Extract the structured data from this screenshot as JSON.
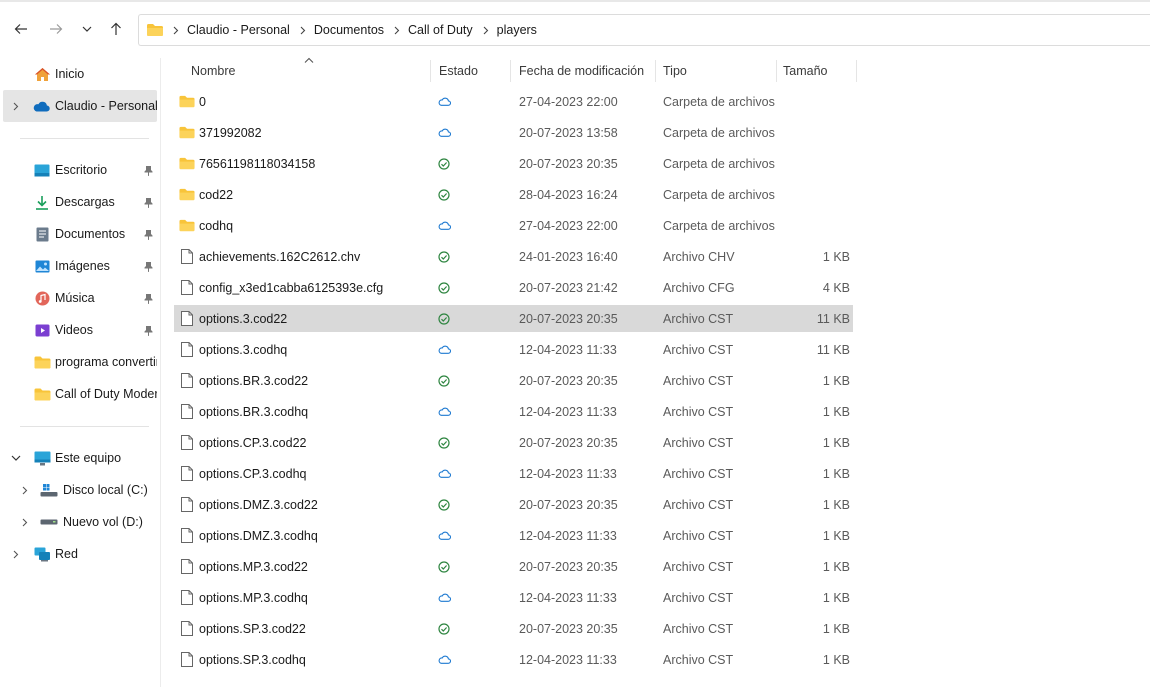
{
  "colors": {
    "accent": "#0078d4",
    "synced": "#2e8540",
    "cloud": "#1f7ad1",
    "folder": "#f8c43a",
    "selected_row": "#d9d9d9"
  },
  "toolbar": {
    "back_icon": "arrow-left-icon",
    "forward_icon": "arrow-right-icon",
    "recent_icon": "chevron-down-icon",
    "up_icon": "arrow-up-icon",
    "breadcrumb": [
      "Claudio - Personal",
      "Documentos",
      "Call of Duty",
      "players"
    ]
  },
  "sidebar": {
    "items": [
      {
        "label": "Inicio",
        "icon": "home-icon"
      },
      {
        "label": "Claudio - Personal",
        "icon": "onedrive-cloud-icon",
        "selected": true
      },
      {
        "label": "Escritorio",
        "icon": "desktop-icon",
        "pinned": true
      },
      {
        "label": "Descargas",
        "icon": "download-icon",
        "pinned": true
      },
      {
        "label": "Documentos",
        "icon": "documents-icon",
        "pinned": true
      },
      {
        "label": "Imágenes",
        "icon": "pictures-icon",
        "pinned": true
      },
      {
        "label": "Música",
        "icon": "music-icon",
        "pinned": true
      },
      {
        "label": "Videos",
        "icon": "videos-icon",
        "pinned": true
      },
      {
        "label": "programa convertir",
        "icon": "folder-icon"
      },
      {
        "label": "Call of Duty  Moder",
        "icon": "folder-icon"
      },
      {
        "label": "Este equipo",
        "icon": "computer-icon"
      },
      {
        "label": "Disco local (C:)",
        "icon": "drive-windows-icon"
      },
      {
        "label": "Nuevo vol (D:)",
        "icon": "drive-icon"
      },
      {
        "label": "Red",
        "icon": "network-icon"
      }
    ]
  },
  "columns": {
    "name": "Nombre",
    "status": "Estado",
    "date": "Fecha de modificación",
    "type": "Tipo",
    "size": "Tamaño"
  },
  "files": [
    {
      "name": "0",
      "kind": "folder",
      "status": "cloud",
      "date": "27-04-2023 22:00",
      "type": "Carpeta de archivos",
      "size": ""
    },
    {
      "name": "371992082",
      "kind": "folder",
      "status": "cloud",
      "date": "20-07-2023 13:58",
      "type": "Carpeta de archivos",
      "size": ""
    },
    {
      "name": "76561198118034158",
      "kind": "folder",
      "status": "synced",
      "date": "20-07-2023 20:35",
      "type": "Carpeta de archivos",
      "size": ""
    },
    {
      "name": "cod22",
      "kind": "folder",
      "status": "synced",
      "date": "28-04-2023 16:24",
      "type": "Carpeta de archivos",
      "size": ""
    },
    {
      "name": "codhq",
      "kind": "folder",
      "status": "cloud",
      "date": "27-04-2023 22:00",
      "type": "Carpeta de archivos",
      "size": ""
    },
    {
      "name": "achievements.162C2612.chv",
      "kind": "file",
      "status": "synced",
      "date": "24-01-2023 16:40",
      "type": "Archivo CHV",
      "size": "1 KB"
    },
    {
      "name": "config_x3ed1cabba6125393e.cfg",
      "kind": "file",
      "status": "synced",
      "date": "20-07-2023 21:42",
      "type": "Archivo CFG",
      "size": "4 KB"
    },
    {
      "name": "options.3.cod22",
      "kind": "file",
      "status": "synced",
      "date": "20-07-2023 20:35",
      "type": "Archivo CST",
      "size": "11 KB",
      "selected": true
    },
    {
      "name": "options.3.codhq",
      "kind": "file",
      "status": "cloud",
      "date": "12-04-2023 11:33",
      "type": "Archivo CST",
      "size": "11 KB"
    },
    {
      "name": "options.BR.3.cod22",
      "kind": "file",
      "status": "synced",
      "date": "20-07-2023 20:35",
      "type": "Archivo CST",
      "size": "1 KB"
    },
    {
      "name": "options.BR.3.codhq",
      "kind": "file",
      "status": "cloud",
      "date": "12-04-2023 11:33",
      "type": "Archivo CST",
      "size": "1 KB"
    },
    {
      "name": "options.CP.3.cod22",
      "kind": "file",
      "status": "synced",
      "date": "20-07-2023 20:35",
      "type": "Archivo CST",
      "size": "1 KB"
    },
    {
      "name": "options.CP.3.codhq",
      "kind": "file",
      "status": "cloud",
      "date": "12-04-2023 11:33",
      "type": "Archivo CST",
      "size": "1 KB"
    },
    {
      "name": "options.DMZ.3.cod22",
      "kind": "file",
      "status": "synced",
      "date": "20-07-2023 20:35",
      "type": "Archivo CST",
      "size": "1 KB"
    },
    {
      "name": "options.DMZ.3.codhq",
      "kind": "file",
      "status": "cloud",
      "date": "12-04-2023 11:33",
      "type": "Archivo CST",
      "size": "1 KB"
    },
    {
      "name": "options.MP.3.cod22",
      "kind": "file",
      "status": "synced",
      "date": "20-07-2023 20:35",
      "type": "Archivo CST",
      "size": "1 KB"
    },
    {
      "name": "options.MP.3.codhq",
      "kind": "file",
      "status": "cloud",
      "date": "12-04-2023 11:33",
      "type": "Archivo CST",
      "size": "1 KB"
    },
    {
      "name": "options.SP.3.cod22",
      "kind": "file",
      "status": "synced",
      "date": "20-07-2023 20:35",
      "type": "Archivo CST",
      "size": "1 KB"
    },
    {
      "name": "options.SP.3.codhq",
      "kind": "file",
      "status": "cloud",
      "date": "12-04-2023 11:33",
      "type": "Archivo CST",
      "size": "1 KB"
    }
  ]
}
